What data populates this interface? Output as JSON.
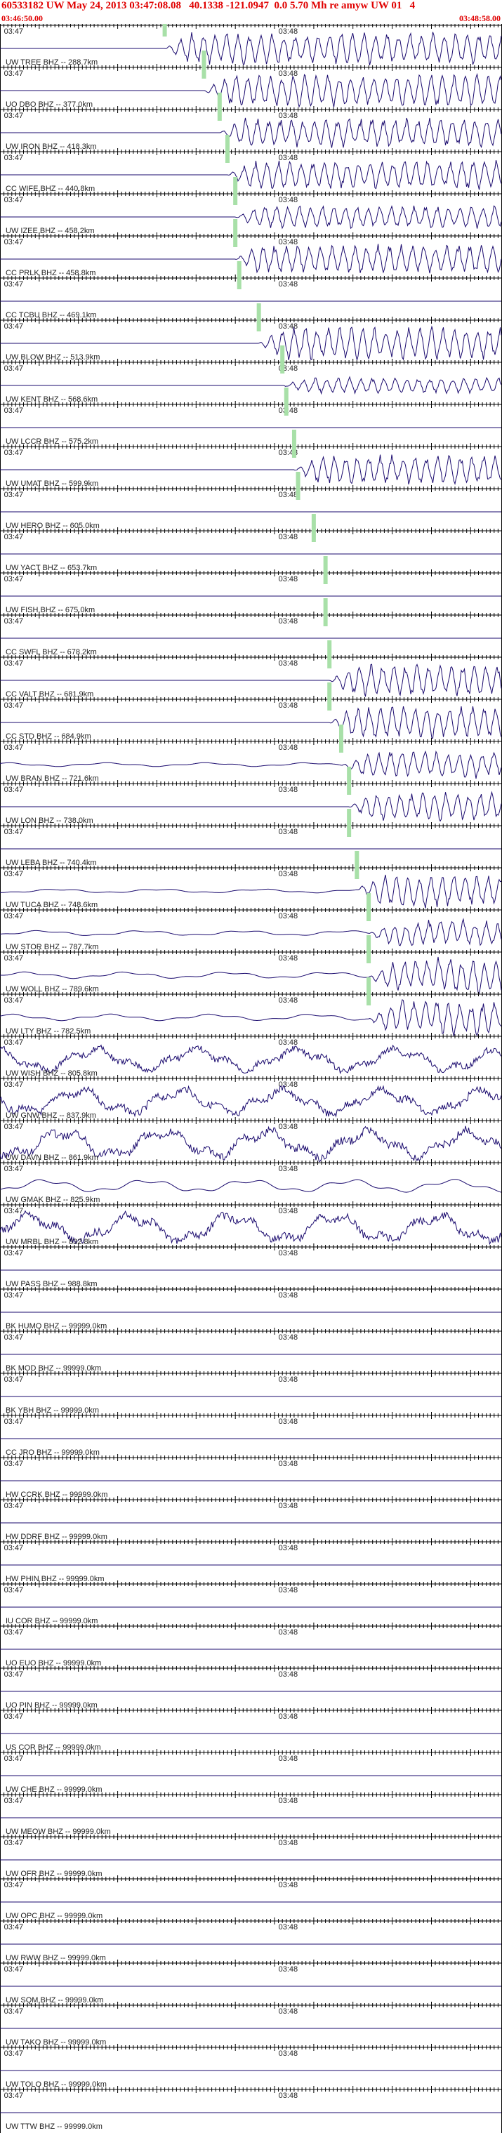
{
  "header": {
    "title": "60533182 UW May 24, 2013 03:47:08.08   40.1338 -121.0947  0.0 5.70 Mh re amyw UW 01   4",
    "start_time": "03:46:50.00",
    "end_time": "03:48:58.00"
  },
  "colors": {
    "header_text": "#e00000",
    "trace": "#1a0a6e",
    "pick": "#a8e0a8",
    "axis": "#000000"
  },
  "chart_data": {
    "type": "seismogram-record-section",
    "time_labels": [
      "03:47",
      "03:48"
    ],
    "stations": [
      {
        "label": "UW TREE BHZ -- 288.7km",
        "pick_s": 42,
        "amp": 1.0,
        "noise": 0
      },
      {
        "label": "UO DBO BHZ -- 377.0km",
        "pick_s": 52,
        "amp": 1.0,
        "noise": 0
      },
      {
        "label": "UW IRON BHZ -- 418.3km",
        "pick_s": 56,
        "amp": 0.9,
        "noise": 0
      },
      {
        "label": "CC WIFE BHZ -- 440.8km",
        "pick_s": 58,
        "amp": 0.9,
        "noise": 0
      },
      {
        "label": "UW IZEE BHZ -- 458.2km",
        "pick_s": 60,
        "amp": 0.7,
        "noise": 0
      },
      {
        "label": "CC PRLK BHZ -- 458.8km",
        "pick_s": 60,
        "amp": 0.9,
        "noise": 0
      },
      {
        "label": "CC TCBU BHZ -- 469.1km",
        "pick_s": 61,
        "amp": 0.0,
        "noise": 0
      },
      {
        "label": "UW BLOW BHZ -- 513.9km",
        "pick_s": 66,
        "amp": 1.0,
        "noise": 0
      },
      {
        "label": "UW KENT BHZ -- 568.6km",
        "pick_s": 72,
        "amp": 0.5,
        "noise": 0
      },
      {
        "label": "UW LCCR BHZ -- 575.2km",
        "pick_s": 73,
        "amp": 0.0,
        "noise": 0
      },
      {
        "label": "UW UMAT BHZ -- 599.9km",
        "pick_s": 75,
        "amp": 0.9,
        "noise": 0
      },
      {
        "label": "UW HERO BHZ -- 605.0km",
        "pick_s": 76,
        "amp": 0.0,
        "noise": 0
      },
      {
        "label": "UW YACT BHZ -- 653.7km",
        "pick_s": 80,
        "amp": 0.0,
        "noise": 0
      },
      {
        "label": "UW FISH BHZ -- 675.0km",
        "pick_s": 83,
        "amp": 0.0,
        "noise": 0
      },
      {
        "label": "CC SWFL BHZ -- 678.2km",
        "pick_s": 83,
        "amp": 0.0,
        "noise": 0
      },
      {
        "label": "CC VALT BHZ -- 681.9km",
        "pick_s": 84,
        "amp": 1.0,
        "noise": 0
      },
      {
        "label": "CC STD BHZ -- 684.9km",
        "pick_s": 84,
        "amp": 1.0,
        "noise": 0
      },
      {
        "label": "UW BRAN BHZ -- 721.6km",
        "pick_s": 87,
        "amp": 0.8,
        "noise": 0.15
      },
      {
        "label": "UW LON BHZ -- 738.0km",
        "pick_s": 89,
        "amp": 0.9,
        "noise": 0
      },
      {
        "label": "UW LEBA BHZ -- 740.4km",
        "pick_s": 89,
        "amp": 0.0,
        "noise": 0
      },
      {
        "label": "UW TUCA BHZ -- 748.6km",
        "pick_s": 91,
        "amp": 1.0,
        "noise": 0.15
      },
      {
        "label": "UW STOR BHZ -- 787.7km",
        "pick_s": 94,
        "amp": 0.8,
        "noise": 0.2
      },
      {
        "label": "UW WOLL BHZ -- 789.6km",
        "pick_s": 94,
        "amp": 1.0,
        "noise": 0.25
      },
      {
        "label": "UW LTY BHZ -- 782.5km",
        "pick_s": 94,
        "amp": 1.0,
        "noise": 0.25
      },
      {
        "label": "UW WISH BHZ -- 805.8km",
        "pick_s": null,
        "amp": 0.0,
        "noise": 0.9
      },
      {
        "label": "UW GNW BHZ -- 837.9km",
        "pick_s": null,
        "amp": 0.0,
        "noise": 1.0
      },
      {
        "label": "UW DAVN BHZ -- 861.9km",
        "pick_s": null,
        "amp": 0.0,
        "noise": 1.1
      },
      {
        "label": "UW GMAK BHZ -- 825.9km",
        "pick_s": null,
        "amp": 0.0,
        "noise": 0.5
      },
      {
        "label": "UW MRBL BHZ -- 832.8km",
        "pick_s": null,
        "amp": 0.0,
        "noise": 1.1
      },
      {
        "label": "UW PASS BHZ -- 988.8km",
        "pick_s": null,
        "amp": 0.0,
        "noise": 0
      },
      {
        "label": "BK HUMO BHZ -- 99999.0km",
        "pick_s": null,
        "amp": 0.0,
        "noise": 0
      },
      {
        "label": "BK MOD BHZ -- 99999.0km",
        "pick_s": null,
        "amp": 0.0,
        "noise": 0
      },
      {
        "label": "BK YBH BHZ -- 99999.0km",
        "pick_s": null,
        "amp": 0.0,
        "noise": 0
      },
      {
        "label": "CC JRO BHZ -- 99999.0km",
        "pick_s": null,
        "amp": 0.0,
        "noise": 0
      },
      {
        "label": "HW CCRK BHZ -- 99999.0km",
        "pick_s": null,
        "amp": 0.0,
        "noise": 0
      },
      {
        "label": "HW DDRF BHZ -- 99999.0km",
        "pick_s": null,
        "amp": 0.0,
        "noise": 0
      },
      {
        "label": "HW PHIN BHZ -- 99999.0km",
        "pick_s": null,
        "amp": 0.0,
        "noise": 0
      },
      {
        "label": "IU COR BHZ -- 99999.0km",
        "pick_s": null,
        "amp": 0.0,
        "noise": 0
      },
      {
        "label": "UO EUO BHZ -- 99999.0km",
        "pick_s": null,
        "amp": 0.0,
        "noise": 0
      },
      {
        "label": "UO PIN BHZ -- 99999.0km",
        "pick_s": null,
        "amp": 0.0,
        "noise": 0
      },
      {
        "label": "US COR BHZ -- 99999.0km",
        "pick_s": null,
        "amp": 0.0,
        "noise": 0
      },
      {
        "label": "UW CHE BHZ -- 99999.0km",
        "pick_s": null,
        "amp": 0.0,
        "noise": 0
      },
      {
        "label": "UW MEOW BHZ -- 99999.0km",
        "pick_s": null,
        "amp": 0.0,
        "noise": 0
      },
      {
        "label": "UW OFR BHZ -- 99999.0km",
        "pick_s": null,
        "amp": 0.0,
        "noise": 0
      },
      {
        "label": "UW OPC BHZ -- 99999.0km",
        "pick_s": null,
        "amp": 0.0,
        "noise": 0
      },
      {
        "label": "UW RWW BHZ -- 99999.0km",
        "pick_s": null,
        "amp": 0.0,
        "noise": 0
      },
      {
        "label": "UW SQM BHZ -- 99999.0km",
        "pick_s": null,
        "amp": 0.0,
        "noise": 0
      },
      {
        "label": "UW TAKO BHZ -- 99999.0km",
        "pick_s": null,
        "amp": 0.0,
        "noise": 0
      },
      {
        "label": "UW TOLO BHZ -- 99999.0km",
        "pick_s": null,
        "amp": 0.0,
        "noise": 0
      },
      {
        "label": "UW TTW BHZ -- 99999.0km",
        "pick_s": null,
        "amp": 0.0,
        "noise": 0
      }
    ]
  }
}
